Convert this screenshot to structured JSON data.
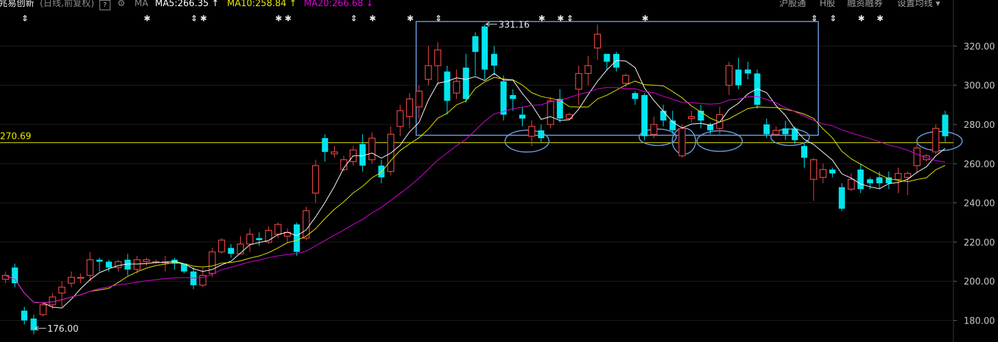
{
  "header": {
    "stock_name": "兆易创新",
    "period": "(日线,前复权)",
    "help_icon": "question-mark-icon",
    "settings_icon": "gear-icon",
    "ma_label": "MA",
    "ma5": "MA5:266.35 ↑",
    "ma10": "MA10:258.84 ↑",
    "ma20": "MA20:266.68 ↓",
    "links": [
      "沪股通",
      "H股",
      "融资融券",
      "设置均线 ▾"
    ]
  },
  "colors": {
    "up": "#e84545",
    "down": "#00e5ee",
    "ma5": "#ffffff",
    "ma10": "#e8e800",
    "ma20": "#e000e0",
    "annotation": "#6a9ce0"
  },
  "chart_data": {
    "type": "candlestick",
    "y_ticks": [
      "180.00",
      "200.00",
      "220.00",
      "240.00",
      "260.00",
      "280.00",
      "300.00",
      "320.00"
    ],
    "ylim": [
      176,
      334
    ],
    "reference_line": {
      "value": 270.69,
      "label": "270.69"
    },
    "high_label": {
      "value": 331.16,
      "text": "331.16"
    },
    "low_label": {
      "value": 176.0,
      "text": "176.00"
    },
    "candles": [
      [
        201,
        203,
        199,
        205
      ],
      [
        207,
        199,
        197,
        209
      ],
      [
        185,
        180,
        178,
        187
      ],
      [
        181,
        175,
        173,
        183
      ],
      [
        183,
        188,
        182,
        189
      ],
      [
        188,
        192,
        186,
        194
      ],
      [
        194,
        197,
        187,
        200
      ],
      [
        199,
        202,
        197,
        205
      ],
      [
        202,
        202,
        199,
        204
      ],
      [
        203,
        211,
        200,
        215
      ],
      [
        211,
        210,
        205,
        212
      ],
      [
        210,
        207,
        205,
        211
      ],
      [
        207,
        210,
        205,
        211
      ],
      [
        211,
        206,
        203,
        214
      ],
      [
        206,
        211,
        204,
        213
      ],
      [
        210,
        211,
        208,
        212
      ],
      [
        210,
        210,
        209,
        211
      ],
      [
        210,
        210,
        205,
        213
      ],
      [
        211,
        209,
        206,
        212
      ],
      [
        209,
        205,
        204,
        209
      ],
      [
        205,
        198,
        196,
        207
      ],
      [
        198,
        203,
        197,
        207
      ],
      [
        204,
        215,
        202,
        217
      ],
      [
        215,
        221,
        214,
        222
      ],
      [
        217,
        214,
        212,
        219
      ],
      [
        214,
        219,
        214,
        223
      ],
      [
        219,
        224,
        215,
        227
      ],
      [
        222,
        221,
        218,
        225
      ],
      [
        220,
        226,
        219,
        228
      ],
      [
        224,
        229,
        222,
        230
      ],
      [
        223,
        225,
        220,
        227
      ],
      [
        229,
        215,
        213,
        230
      ],
      [
        222,
        236,
        221,
        238
      ],
      [
        245,
        259,
        240,
        262
      ],
      [
        273,
        266,
        261,
        275
      ],
      [
        265,
        266,
        263,
        269
      ],
      [
        257,
        262,
        256,
        264
      ],
      [
        261,
        267,
        259,
        269
      ],
      [
        270,
        259,
        256,
        275
      ],
      [
        262,
        273,
        260,
        276
      ],
      [
        259,
        253,
        250,
        262
      ],
      [
        256,
        275,
        254,
        279
      ],
      [
        279,
        287,
        274,
        290
      ],
      [
        284,
        293,
        278,
        296
      ],
      [
        289,
        297,
        283,
        300
      ],
      [
        303,
        310,
        300,
        320
      ],
      [
        310,
        318,
        300,
        322
      ],
      [
        307,
        292,
        285,
        310
      ],
      [
        296,
        302,
        293,
        308
      ],
      [
        309,
        293,
        291,
        316
      ],
      [
        325,
        317,
        305,
        327
      ],
      [
        330,
        308,
        303,
        331
      ],
      [
        316,
        310,
        305,
        320
      ],
      [
        302,
        285,
        282,
        305
      ],
      [
        295,
        293,
        287,
        298
      ],
      [
        285,
        283,
        279,
        289
      ],
      [
        274,
        279,
        269,
        282
      ],
      [
        277,
        273,
        271,
        280
      ],
      [
        280,
        292,
        278,
        294
      ],
      [
        293,
        283,
        281,
        298
      ],
      [
        283,
        285,
        282,
        286
      ],
      [
        298,
        306,
        290,
        310
      ],
      [
        306,
        310,
        300,
        315
      ],
      [
        319,
        326,
        313,
        331
      ],
      [
        316,
        312,
        308,
        316
      ],
      [
        316,
        309,
        307,
        317
      ],
      [
        301,
        305,
        299,
        306
      ],
      [
        296,
        293,
        290,
        297
      ],
      [
        295,
        274,
        272,
        296
      ],
      [
        275,
        280,
        273,
        284
      ],
      [
        287,
        282,
        279,
        290
      ],
      [
        282,
        277,
        275,
        287
      ],
      [
        264,
        278,
        263,
        280
      ],
      [
        283,
        284,
        281,
        287
      ],
      [
        287,
        282,
        278,
        290
      ],
      [
        280,
        277,
        275,
        281
      ],
      [
        278,
        285,
        275,
        289
      ],
      [
        300,
        310,
        295,
        312
      ],
      [
        308,
        300,
        298,
        314
      ],
      [
        308,
        306,
        303,
        312
      ],
      [
        306,
        290,
        288,
        308
      ],
      [
        280,
        275,
        273,
        283
      ],
      [
        275,
        277,
        274,
        279
      ],
      [
        278,
        275,
        272,
        282
      ],
      [
        278,
        272,
        270,
        279
      ],
      [
        269,
        263,
        258,
        271
      ],
      [
        252,
        262,
        241,
        263
      ],
      [
        253,
        257,
        250,
        260
      ],
      [
        257,
        255,
        253,
        258
      ],
      [
        248,
        237,
        236,
        250
      ],
      [
        247,
        252,
        246,
        255
      ],
      [
        257,
        247,
        245,
        260
      ],
      [
        252,
        250,
        247,
        253
      ],
      [
        253,
        250,
        247,
        256
      ],
      [
        253,
        250,
        247,
        256
      ],
      [
        252,
        255,
        245,
        258
      ],
      [
        253,
        255,
        244,
        256
      ],
      [
        259,
        268,
        255,
        270
      ],
      [
        262,
        264,
        261,
        265
      ],
      [
        266,
        278,
        265,
        280
      ],
      [
        285,
        274,
        271,
        287
      ]
    ],
    "ma5": [],
    "ma10": [],
    "ma20": []
  }
}
